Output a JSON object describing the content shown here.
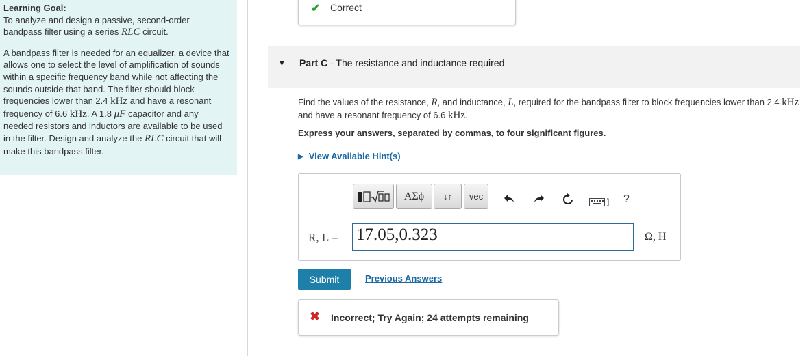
{
  "sidebar": {
    "goal_title": "Learning Goal:",
    "goal_text": "To analyze and design a passive, second-order bandpass filter using a series",
    "goal_math": "RLC",
    "goal_tail": "circuit.",
    "desc_1": "A bandpass filter is needed for an equalizer, a device that allows one to select the level of amplification of sounds within a specific frequency band while not affecting the sounds outside that band. The filter should block frequencies lower than 2.4",
    "desc_khz1": "kHz",
    "desc_2": "and have a resonant frequency of 6.6",
    "desc_khz2": "kHz",
    "desc_3": ". A 1.8",
    "desc_uf": "μF",
    "desc_4": "capacitor and any needed resistors and inductors are available to be used in the filter. Design and analyze the",
    "desc_rlc": "RLC",
    "desc_5": "circuit that will make this bandpass filter."
  },
  "correct_feedback": {
    "icon": "checkmark-icon",
    "text": "Correct"
  },
  "part": {
    "label": "Part C",
    "title": " - The resistance and inductance required"
  },
  "question": {
    "t1": "Find the values of the resistance,",
    "R": "R",
    "t2": ", and inductance,",
    "L": "L",
    "t3": ", required for the bandpass filter to block frequencies lower than 2.4",
    "khz1": "kHz",
    "t4": "and have a resonant frequency of 6.6",
    "khz2": "kHz",
    "t5": "."
  },
  "instruction": "Express your answers, separated by commas, to four significant figures.",
  "hints_label": "View Available Hint(s)",
  "toolbar": {
    "greek_label": "ΑΣϕ",
    "arrows_label": "↓↑",
    "vec_label": "vec",
    "help_label": "?"
  },
  "answer": {
    "label": "R, L =",
    "value": "17.05,0.323",
    "units": "Ω, H"
  },
  "submit_label": "Submit",
  "previous_answers_label": "Previous Answers",
  "incorrect_feedback": {
    "icon": "x-icon",
    "text": "Incorrect; Try Again; 24 attempts remaining"
  },
  "colors": {
    "sidebar_bg": "#e3f4f5",
    "link": "#1b6aa5",
    "submit_bg": "#1e7fa8",
    "correct": "#2e9e2e",
    "incorrect": "#d0262a",
    "input_border": "#2f6b96"
  }
}
